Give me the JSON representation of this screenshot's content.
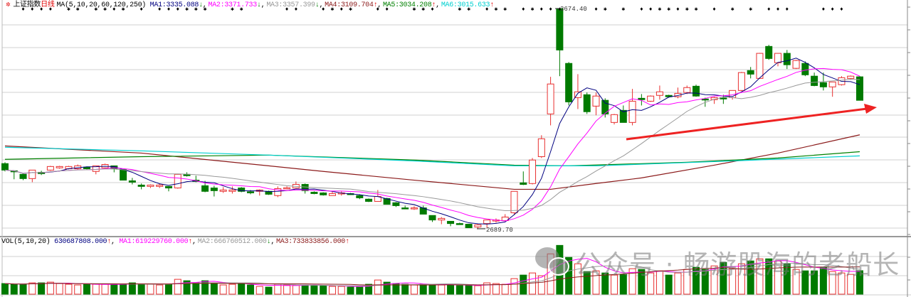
{
  "header": {
    "icon": "gear-icon",
    "index_name": "上证指数",
    "period": "日线",
    "ma_params": "MA(5,10,20,60,120,250)",
    "mas": [
      {
        "label": "MA1:",
        "value": "3335.088",
        "arrow": "↓",
        "color": "#000080"
      },
      {
        "label": "MA2:",
        "value": "3371.733",
        "arrow": "↓",
        "color": "#ff00ff"
      },
      {
        "label": "MA3:",
        "value": "3357.399",
        "arrow": "↓",
        "color": "#999999"
      },
      {
        "label": "MA4:",
        "value": "3109.704",
        "arrow": "↑",
        "color": "#8b1a1a"
      },
      {
        "label": "MA5:",
        "value": "3034.208",
        "arrow": "↑",
        "color": "#008000"
      },
      {
        "label": "MA6:",
        "value": "3015.633",
        "arrow": "↑",
        "color": "#00d0d0"
      }
    ]
  },
  "volume_header": {
    "params": "VOL(5,10,20)",
    "value": "630687808.000",
    "value_arrow": "↑",
    "value_color": "#000080",
    "mas": [
      {
        "label": "MA1:",
        "value": "619229760.000",
        "arrow": "↑",
        "color": "#ff00ff"
      },
      {
        "label": "MA2:",
        "value": "666760512.000",
        "arrow": "↓",
        "color": "#999999"
      },
      {
        "label": "MA3:",
        "value": "733833856.000",
        "arrow": "↑",
        "color": "#8b1a1a"
      }
    ]
  },
  "watermark": "公众号 · 畅游股海的老船长",
  "colors": {
    "up": "#e83030",
    "down": "#007a00",
    "grid": "#d0d0d0",
    "arrow": "#ee2222"
  },
  "chart_data": {
    "type": "candlestick",
    "title": "上证指数 日线",
    "ylim": [
      2680,
      3690
    ],
    "high_label": "3674.40",
    "low_label": "2689.70",
    "candle_fields": [
      "open",
      "close",
      "high",
      "low"
    ],
    "candles": [
      [
        2981,
        2952,
        2987,
        2946
      ],
      [
        2949,
        2946,
        2949,
        2911
      ],
      [
        2933,
        2914,
        2939,
        2907
      ],
      [
        2914,
        2952,
        2952,
        2898
      ],
      [
        2942,
        2936,
        2949,
        2930
      ],
      [
        2952,
        2968,
        2971,
        2949
      ],
      [
        2962,
        2968,
        2971,
        2958
      ],
      [
        2958,
        2968,
        2971,
        2955
      ],
      [
        2958,
        2971,
        2977,
        2955
      ],
      [
        2965,
        2958,
        2968,
        2955
      ],
      [
        2946,
        2971,
        2971,
        2933
      ],
      [
        2962,
        2977,
        2981,
        2958
      ],
      [
        2971,
        2958,
        2971,
        2942
      ],
      [
        2955,
        2907,
        2955,
        2907
      ],
      [
        2904,
        2898,
        2917,
        2888
      ],
      [
        2885,
        2879,
        2892,
        2866
      ],
      [
        2879,
        2885,
        2888,
        2872
      ],
      [
        2879,
        2885,
        2892,
        2872
      ],
      [
        2879,
        2872,
        2879,
        2857
      ],
      [
        2872,
        2933,
        2933,
        2869
      ],
      [
        2933,
        2927,
        2942,
        2923
      ],
      [
        2907,
        2901,
        2927,
        2898
      ],
      [
        2882,
        2857,
        2904,
        2853
      ],
      [
        2872,
        2860,
        2882,
        2834
      ],
      [
        2857,
        2863,
        2876,
        2850
      ],
      [
        2857,
        2863,
        2879,
        2847
      ],
      [
        2872,
        2857,
        2876,
        2853
      ],
      [
        2855,
        2852,
        2863,
        2844
      ],
      [
        2857,
        2863,
        2866,
        2838
      ],
      [
        2857,
        2844,
        2860,
        2841
      ],
      [
        2838,
        2869,
        2879,
        2831
      ],
      [
        2871,
        2873,
        2879,
        2866
      ],
      [
        2872,
        2888,
        2901,
        2872
      ],
      [
        2888,
        2860,
        2892,
        2847
      ],
      [
        2853,
        2847,
        2857,
        2844
      ],
      [
        2850,
        2841,
        2853,
        2838
      ],
      [
        2838,
        2847,
        2857,
        2838
      ],
      [
        2847,
        2850,
        2857,
        2838
      ],
      [
        2847,
        2844,
        2850,
        2841
      ],
      [
        2838,
        2828,
        2844,
        2822
      ],
      [
        2822,
        2812,
        2825,
        2809
      ],
      [
        2812,
        2834,
        2863,
        2812
      ],
      [
        2825,
        2799,
        2828,
        2799
      ],
      [
        2806,
        2793,
        2809,
        2787
      ],
      [
        2783,
        2780,
        2793,
        2777
      ],
      [
        2780,
        2783,
        2790,
        2774
      ],
      [
        2783,
        2755,
        2793,
        2755
      ],
      [
        2749,
        2729,
        2749,
        2720
      ],
      [
        2729,
        2736,
        2742,
        2710
      ],
      [
        2723,
        2713,
        2723,
        2701
      ],
      [
        2713,
        2710,
        2717,
        2707
      ],
      [
        2710,
        2694,
        2710,
        2694
      ],
      [
        2698,
        2707,
        2710,
        2689.7
      ],
      [
        2713,
        2729,
        2729,
        2694
      ],
      [
        2727,
        2729,
        2736,
        2717
      ],
      [
        2726,
        2742,
        2755,
        2726
      ],
      [
        2761,
        2857,
        2857,
        2752
      ],
      [
        2895,
        2888,
        2946,
        2885
      ],
      [
        2892,
        2997,
        3006,
        2888
      ],
      [
        3012,
        3092,
        3108,
        3006
      ],
      [
        3203,
        3337,
        3369,
        3152
      ],
      [
        3674.4,
        3489,
        3674.4,
        3372
      ],
      [
        3429,
        3257,
        3435,
        3241
      ],
      [
        3276,
        3302,
        3381,
        3225
      ],
      [
        3289,
        3213,
        3299,
        3203
      ],
      [
        3238,
        3283,
        3299,
        3197
      ],
      [
        3264,
        3203,
        3273,
        3187
      ],
      [
        3165,
        3200,
        3203,
        3156
      ],
      [
        3219,
        3165,
        3241,
        3165
      ],
      [
        3165,
        3260,
        3315,
        3152
      ],
      [
        3273,
        3267,
        3292,
        3241
      ],
      [
        3260,
        3283,
        3286,
        3257
      ],
      [
        3286,
        3302,
        3330,
        3267
      ],
      [
        3286,
        3280,
        3289,
        3276
      ],
      [
        3280,
        3295,
        3321,
        3273
      ],
      [
        3299,
        3321,
        3330,
        3292
      ],
      [
        3327,
        3283,
        3334,
        3280
      ],
      [
        3270,
        3267,
        3276,
        3235
      ],
      [
        3267,
        3276,
        3280,
        3248
      ],
      [
        3276,
        3270,
        3289,
        3248
      ],
      [
        3276,
        3308,
        3308,
        3267
      ],
      [
        3308,
        3388,
        3391,
        3305
      ],
      [
        3397,
        3381,
        3413,
        3362
      ],
      [
        3362,
        3474,
        3476,
        3360
      ],
      [
        3505,
        3451,
        3512,
        3445
      ],
      [
        3432,
        3474,
        3474,
        3416
      ],
      [
        3474,
        3423,
        3489,
        3404
      ],
      [
        3407,
        3442,
        3445,
        3404
      ],
      [
        3429,
        3378,
        3438,
        3372
      ],
      [
        3372,
        3330,
        3388,
        3327
      ],
      [
        3343,
        3324,
        3388,
        3308
      ],
      [
        3324,
        3346,
        3346,
        3280
      ],
      [
        3334,
        3365,
        3372,
        3330
      ],
      [
        3362,
        3372,
        3375,
        3356
      ],
      [
        3369,
        3264,
        3372,
        3264
      ]
    ],
    "volume_unit": "million shares",
    "volumes": [
      285,
      266,
      266,
      304,
      304,
      323,
      285,
      266,
      247,
      266,
      266,
      266,
      266,
      266,
      304,
      266,
      266,
      247,
      266,
      399,
      361,
      304,
      361,
      304,
      247,
      266,
      285,
      247,
      209,
      190,
      266,
      247,
      247,
      247,
      228,
      228,
      209,
      209,
      190,
      190,
      266,
      380,
      323,
      285,
      266,
      247,
      266,
      266,
      247,
      247,
      228,
      228,
      228,
      304,
      285,
      266,
      418,
      513,
      570,
      494,
      1083,
      1311,
      988,
      817,
      608,
      627,
      570,
      513,
      532,
      684,
      665,
      570,
      627,
      513,
      570,
      665,
      722,
      665,
      760,
      855,
      684,
      817,
      893,
      950,
      950,
      893,
      817,
      665,
      627,
      627,
      722,
      608,
      570,
      532,
      631
    ],
    "ma_periods": [
      5,
      10,
      20
    ],
    "volume_ma_periods": [
      5,
      10,
      20
    ],
    "long_mas": [
      {
        "name": "MA4",
        "color": "#8b1a1a",
        "points": [
          [
            0,
            3060
          ],
          [
            15,
            3028
          ],
          [
            29,
            2971
          ],
          [
            35,
            2946
          ],
          [
            45,
            2907
          ],
          [
            56,
            2866
          ],
          [
            60,
            2866
          ],
          [
            65,
            2892
          ],
          [
            70,
            2917
          ],
          [
            78,
            2974
          ],
          [
            85,
            3028
          ],
          [
            94,
            3109.7
          ]
        ]
      },
      {
        "name": "MA5",
        "color": "#008000",
        "points": [
          [
            0,
            3000
          ],
          [
            15,
            3012
          ],
          [
            29,
            3019
          ],
          [
            45,
            2997
          ],
          [
            56,
            2974
          ],
          [
            62,
            2971
          ],
          [
            75,
            2987
          ],
          [
            85,
            3006
          ],
          [
            94,
            3034.2
          ]
        ]
      },
      {
        "name": "MA6",
        "color": "#00d0d0",
        "points": [
          [
            0,
            3054
          ],
          [
            15,
            3038
          ],
          [
            29,
            3019
          ],
          [
            45,
            2993
          ],
          [
            56,
            2971
          ],
          [
            65,
            2971
          ],
          [
            80,
            2993
          ],
          [
            94,
            3015.6
          ]
        ]
      }
    ],
    "markers_star": [
      7,
      8,
      10,
      11,
      13,
      20,
      21,
      22,
      25,
      26,
      36,
      38,
      45,
      46,
      50,
      51,
      54,
      55,
      58,
      66,
      68,
      72,
      73,
      75,
      76,
      80,
      82
    ],
    "markers_diamond": [
      2,
      3,
      4,
      5,
      12,
      15,
      17,
      18,
      19,
      31,
      32,
      35,
      37,
      41,
      42,
      47,
      53,
      57,
      59,
      60,
      61,
      65,
      70,
      71,
      74,
      78,
      84,
      85,
      86,
      90,
      91,
      92
    ]
  }
}
